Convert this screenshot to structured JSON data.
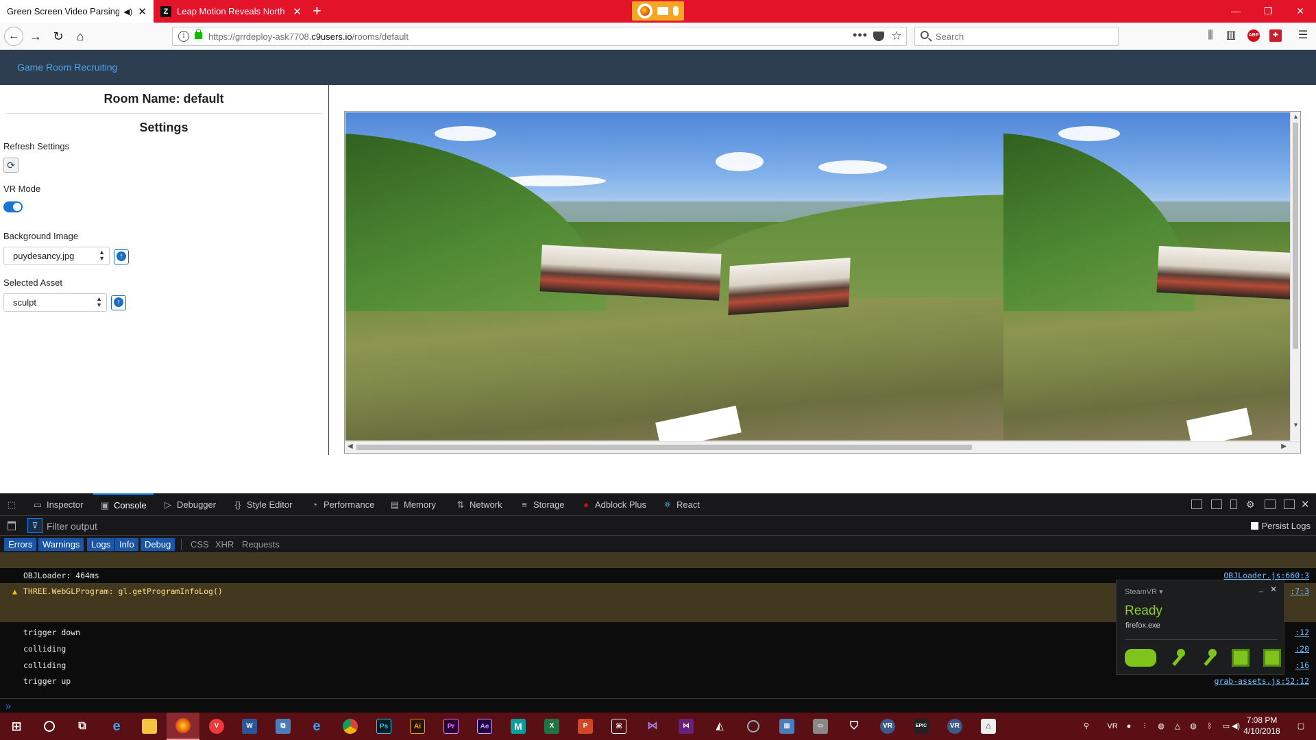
{
  "browser": {
    "tabs": [
      {
        "label": "Green Screen Video Parsing",
        "active": true
      },
      {
        "label": "Leap Motion Reveals North Sta",
        "active": false
      }
    ],
    "url_prefix": "https://grrdeploy-ask7708.",
    "url_domain": "c9users.io",
    "url_path": "/rooms/default",
    "search_placeholder": "Search"
  },
  "page": {
    "brand": "Game Room Recruiting",
    "room_title": "Room Name: default",
    "settings_title": "Settings",
    "refresh_label": "Refresh Settings",
    "vr_mode_label": "VR Mode",
    "vr_mode_on": true,
    "background_label": "Background Image",
    "background_value": "puydesancy.jpg",
    "asset_label": "Selected Asset",
    "asset_value": "sculpt"
  },
  "devtools": {
    "tabs": [
      "Inspector",
      "Console",
      "Debugger",
      "Style Editor",
      "Performance",
      "Memory",
      "Network",
      "Storage",
      "Adblock Plus",
      "React"
    ],
    "active_tab": "Console",
    "filter_placeholder": "Filter output",
    "persist_label": "Persist Logs",
    "levels": [
      {
        "label": "Errors",
        "on": true
      },
      {
        "label": "Warnings",
        "on": true
      },
      {
        "label": "Logs",
        "on": true
      },
      {
        "label": "Info",
        "on": true
      },
      {
        "label": "Debug",
        "on": true
      }
    ],
    "types": [
      "CSS",
      "XHR",
      "Requests"
    ],
    "logs": [
      {
        "text": "OBJLoader: 464ms",
        "level": "log",
        "src": "OBJLoader.js:660:3"
      },
      {
        "text": "THREE.WebGLProgram: gl.getProgramInfoLog()",
        "level": "warn",
        "src": ":7:3"
      },
      {
        "text": "trigger down",
        "level": "log",
        "src": ":12"
      },
      {
        "text": "colliding",
        "level": "log",
        "src": ":20"
      },
      {
        "text": "colliding",
        "level": "log",
        "src": ":16"
      },
      {
        "text": "trigger up",
        "level": "log",
        "src": "grab-assets.js:52:12"
      }
    ]
  },
  "steamvr": {
    "title": "SteamVR",
    "status": "Ready",
    "process": "firefox.exe"
  },
  "taskbar": {
    "time": "7:08 PM",
    "date": "4/10/2018",
    "accent": "#5a0f14"
  }
}
